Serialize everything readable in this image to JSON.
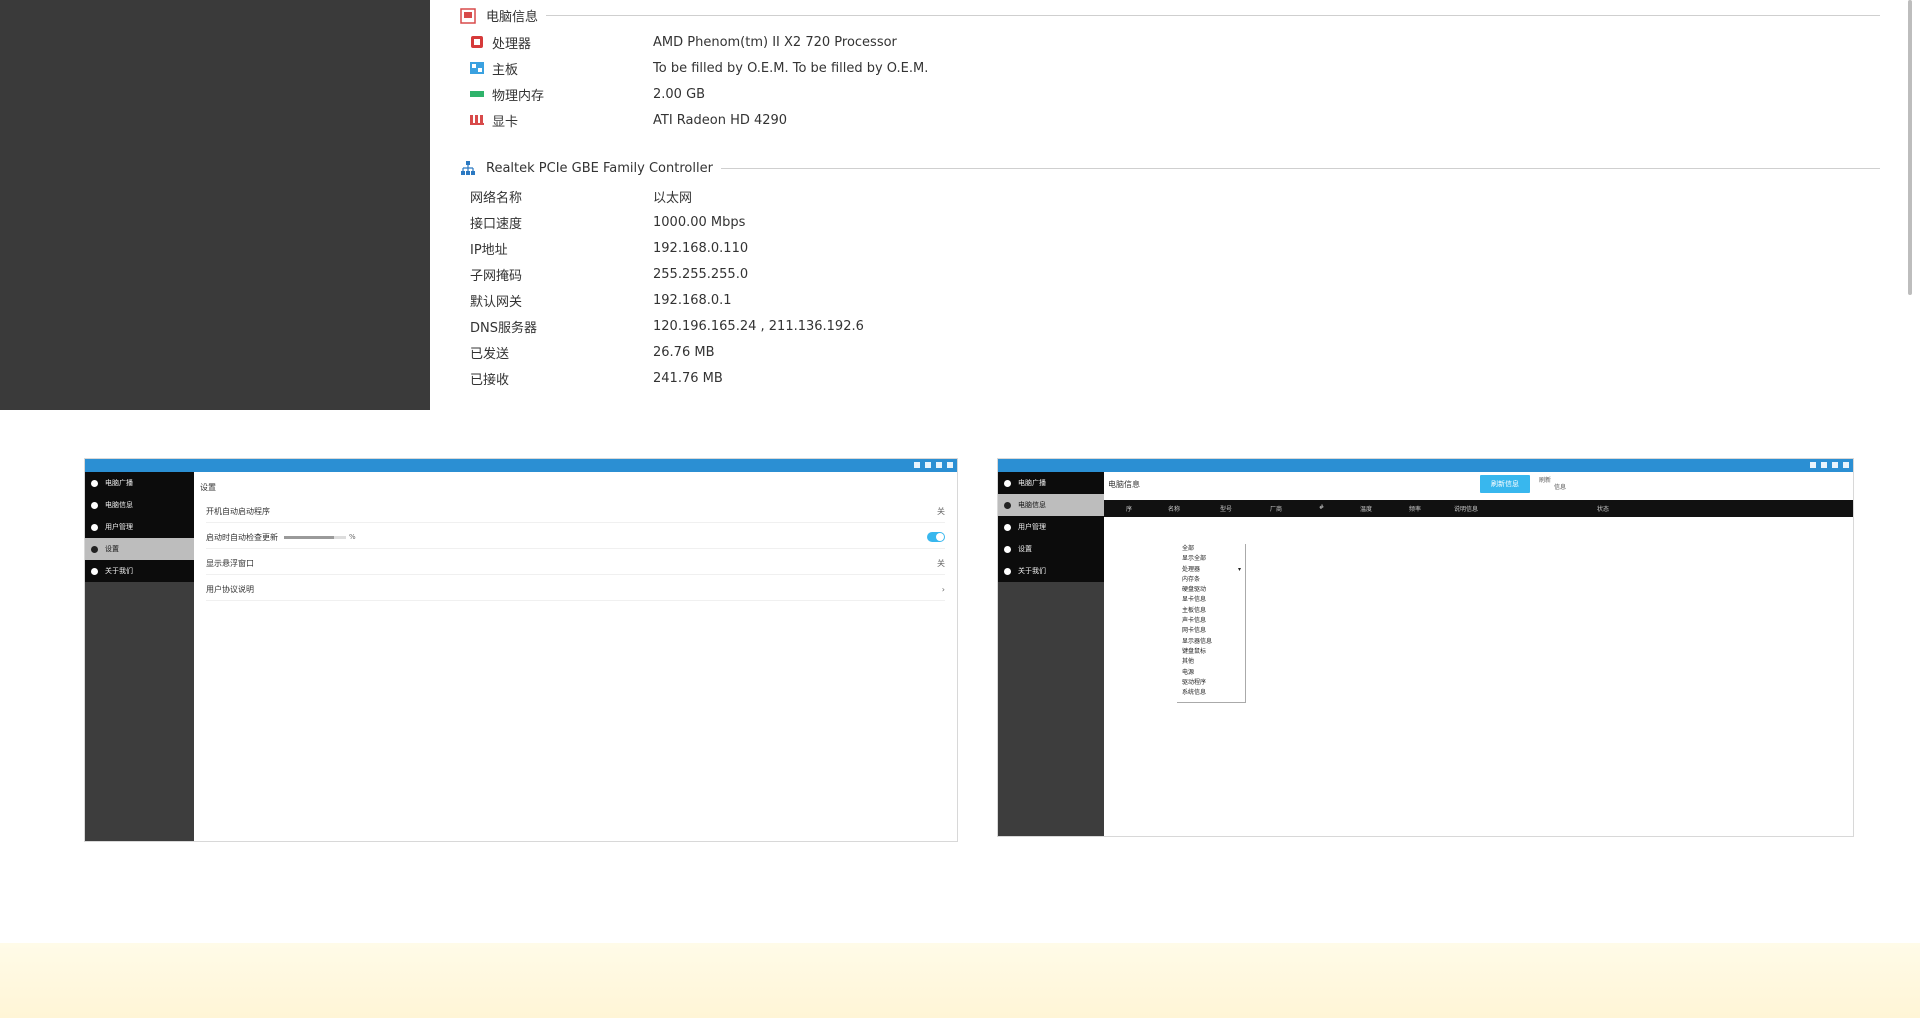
{
  "hardware": {
    "title": "电脑信息",
    "items": [
      {
        "label": "处理器",
        "value": "AMD Phenom(tm) II X2 720 Processor",
        "color": "#d63a3a"
      },
      {
        "label": "主板",
        "value": "To be filled by O.E.M. To be filled by O.E.M.",
        "color": "#3aa1e0"
      },
      {
        "label": "物理内存",
        "value": "2.00 GB",
        "color": "#2fb36b"
      },
      {
        "label": "显卡",
        "value": "ATI Radeon HD 4290",
        "color": "#d84a4a"
      }
    ]
  },
  "network": {
    "title": "Realtek PCIe GBE Family Controller",
    "items": [
      {
        "label": "网络名称",
        "value": "以太网"
      },
      {
        "label": "接口速度",
        "value": "1000.00 Mbps"
      },
      {
        "label": "IP地址",
        "value": "192.168.0.110"
      },
      {
        "label": "子网掩码",
        "value": "255.255.255.0"
      },
      {
        "label": "默认网关",
        "value": "192.168.0.1"
      },
      {
        "label": "DNS服务器",
        "value": "120.196.165.24 , 211.136.192.6"
      },
      {
        "label": "已发送",
        "value": "26.76 MB"
      },
      {
        "label": "已接收",
        "value": "241.76 MB"
      }
    ]
  },
  "window1": {
    "sidebar": [
      {
        "label": "电脑广播"
      },
      {
        "label": "电脑信息"
      },
      {
        "label": "用户管理"
      },
      {
        "label": "设置"
      },
      {
        "label": "关于我们"
      }
    ],
    "active_index": 3,
    "content_title": "设置",
    "settings": [
      {
        "label": "开机自动启动程序",
        "right": "关"
      },
      {
        "label": "启动时自动检查更新",
        "right": "",
        "progress": 0.8,
        "pct": "%"
      },
      {
        "label": "显示悬浮窗口",
        "right": "关"
      },
      {
        "label": "用户协议说明",
        "right": "›"
      }
    ]
  },
  "window2": {
    "sidebar": [
      {
        "label": "电脑广播"
      },
      {
        "label": "电脑信息"
      },
      {
        "label": "用户管理"
      },
      {
        "label": "设置"
      },
      {
        "label": "关于我们"
      }
    ],
    "active_index": 1,
    "content_title": "电脑信息",
    "button": "刷新信息",
    "note1": "刷新",
    "note2": "信息",
    "columns": [
      "序",
      "名称",
      "型号",
      "厂商",
      "#",
      "温度",
      "频率",
      "说明信息",
      "状态"
    ],
    "dropdown": [
      "全部",
      "显示全部",
      "处理器",
      "内存条",
      "硬盘驱动",
      "显卡信息",
      "主板信息",
      "声卡信息",
      "网卡信息",
      "显示器信息",
      "键盘鼠标",
      "其他",
      "电源",
      "驱动程序",
      "系统信息"
    ]
  }
}
